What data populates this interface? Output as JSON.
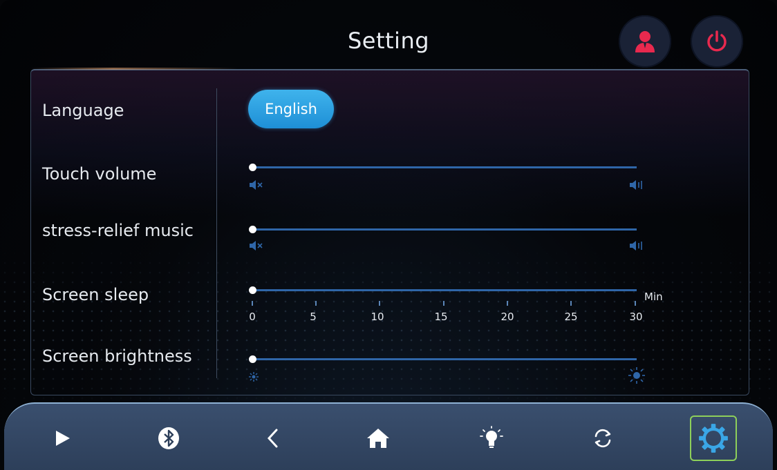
{
  "header": {
    "title": "Setting",
    "user_button_icon": "user-icon",
    "power_button_icon": "power-icon"
  },
  "settings": {
    "language": {
      "label": "Language",
      "value": "English"
    },
    "touch_volume": {
      "label": "Touch volume",
      "level": 0,
      "min_icon": "mute-icon",
      "max_icon": "volume-icon"
    },
    "stress_relief_music": {
      "label": "stress-relief music",
      "level": 0,
      "min_icon": "mute-icon",
      "max_icon": "volume-icon"
    },
    "screen_sleep": {
      "label": "Screen sleep",
      "level_min": 0,
      "unit": "Min",
      "ticks": [
        "0",
        "5",
        "10",
        "15",
        "20",
        "25",
        "30"
      ]
    },
    "screen_brightness": {
      "label": "Screen brightness",
      "level": 0,
      "min_icon": "dim-sun-icon",
      "max_icon": "bright-sun-icon"
    }
  },
  "navbar": {
    "items": [
      {
        "name": "play",
        "icon": "play-icon"
      },
      {
        "name": "bluetooth",
        "icon": "bluetooth-icon"
      },
      {
        "name": "back",
        "icon": "chevron-left-icon"
      },
      {
        "name": "home",
        "icon": "home-icon"
      },
      {
        "name": "light",
        "icon": "lightbulb-icon"
      },
      {
        "name": "sync",
        "icon": "sync-icon"
      },
      {
        "name": "settings",
        "icon": "gear-icon",
        "active": true
      }
    ]
  },
  "colors": {
    "accent": "#2f66a8",
    "button_blue": "#2a9fe3",
    "icon_red": "#e8294e",
    "active_outline": "#8ed05a",
    "icon_blue": "#3aa6e6"
  }
}
